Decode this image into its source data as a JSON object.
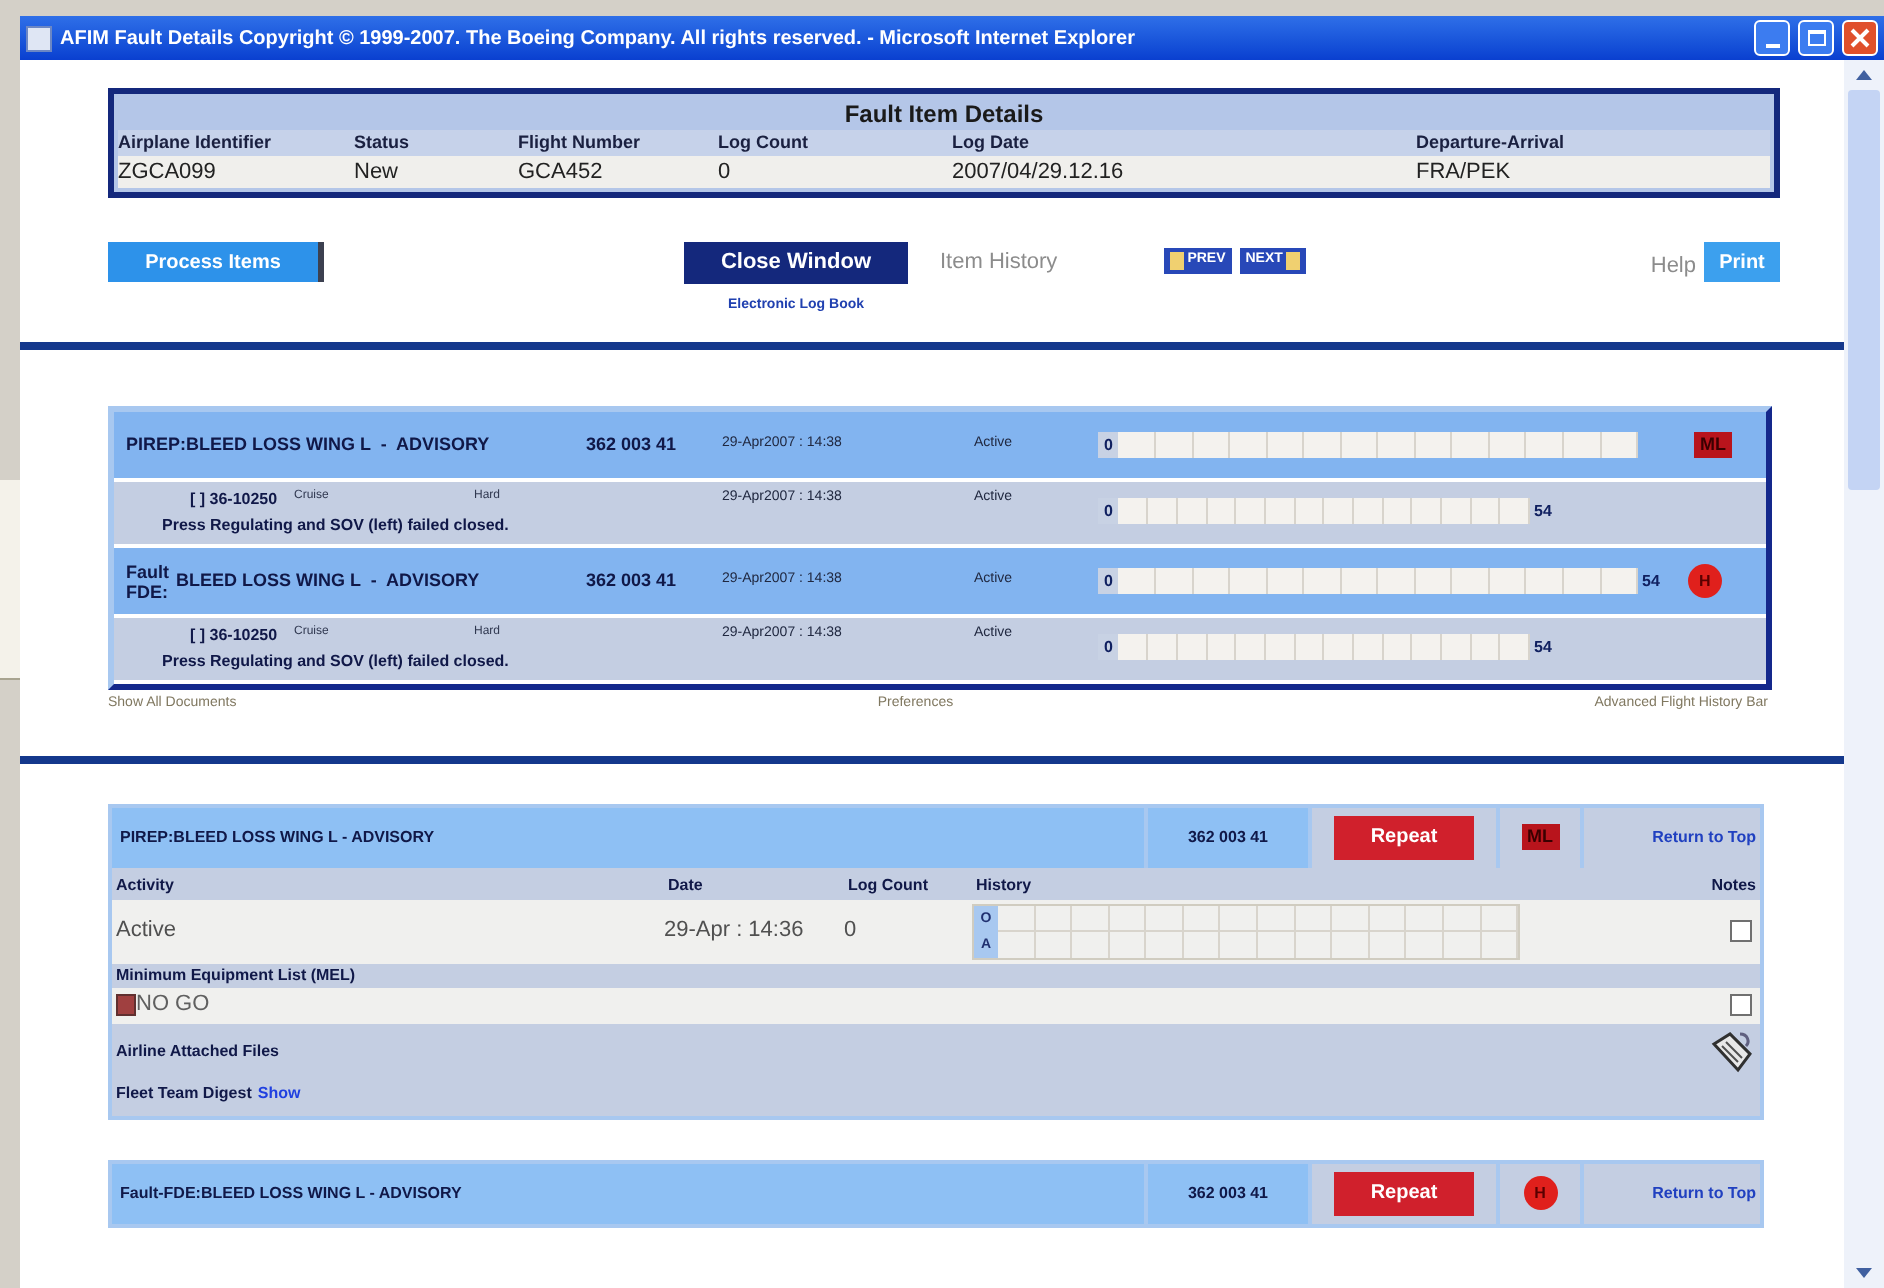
{
  "window": {
    "title": "AFIM Fault Details Copyright © 1999-2007. The Boeing Company.  All rights reserved. - Microsoft Internet Explorer"
  },
  "fault_item_details": {
    "title": "Fault Item Details",
    "columns": [
      "Airplane Identifier",
      "Status",
      "Flight Number",
      "Log Count",
      "Log Date",
      "Departure-Arrival"
    ],
    "values": [
      "ZGCA099",
      "New",
      "GCA452",
      "0",
      "2007/04/29.12.16",
      "FRA/PEK"
    ]
  },
  "toolbar": {
    "process_button": "Process Items",
    "close_button": "Close Window",
    "item_history": "Item History",
    "prev_button": "PREV",
    "next_button": "NEXT",
    "help": "Help",
    "print_button": "Print",
    "log_link": "Electronic Log Book"
  },
  "fault_list": [
    {
      "kind": "parent",
      "name": "PIREP:BLEED LOSS WING L  -  ADVISORY",
      "code": "362 003 41",
      "date": "29-Apr2007 : 14:38",
      "status": "Active",
      "start": "0",
      "badge": {
        "kind": "ml",
        "text": "ML"
      }
    },
    {
      "kind": "child",
      "id": "[ ] 36-10250",
      "phase": "Cruise",
      "type": "Hard",
      "date": "29-Apr2007 : 14:38",
      "status": "Active",
      "description": "Press Regulating and SOV (left) failed closed.",
      "start": "0",
      "end": "54"
    },
    {
      "kind": "parent",
      "prefix": "Fault FDE:",
      "name": "BLEED LOSS WING L  -  ADVISORY",
      "code": "362 003 41",
      "date": "29-Apr2007 : 14:38",
      "status": "Active",
      "start": "0",
      "end": "54",
      "badge": {
        "kind": "h",
        "text": "H"
      }
    },
    {
      "kind": "child",
      "id": "[ ] 36-10250",
      "phase": "Cruise",
      "type": "Hard",
      "date": "29-Apr2007 : 14:38",
      "status": "Active",
      "description": "Press Regulating and SOV (left) failed closed.",
      "start": "0",
      "end": "54"
    }
  ],
  "list_footer": {
    "left": "Show All Documents",
    "center": "Preferences",
    "right": "Advanced Flight History Bar"
  },
  "cards": [
    {
      "title": "PIREP:BLEED LOSS WING L - ADVISORY",
      "code": "362 003 41",
      "repeat": "Repeat",
      "badge": {
        "kind": "ml",
        "text": "ML"
      },
      "return_link": "Return to Top",
      "details": {
        "columns": [
          "Activity",
          "Date",
          "Log Count",
          "History",
          "Notes"
        ],
        "activity": "Active",
        "date": "29-Apr : 14:36",
        "log_count": "0",
        "history_labels": [
          "O",
          "A"
        ],
        "notes_checked": false,
        "mel_label": "Minimum Equipment List (MEL)",
        "mel_value": "NO GO",
        "mel_checked": false,
        "attached_label": "Airline Attached Files",
        "digest_label": "Fleet Team Digest",
        "digest_link": "Show"
      }
    },
    {
      "title": "Fault-FDE:BLEED LOSS WING L - ADVISORY",
      "code": "362 003 41",
      "repeat": "Repeat",
      "badge": {
        "kind": "h",
        "text": "H"
      },
      "return_link": "Return to Top"
    }
  ]
}
